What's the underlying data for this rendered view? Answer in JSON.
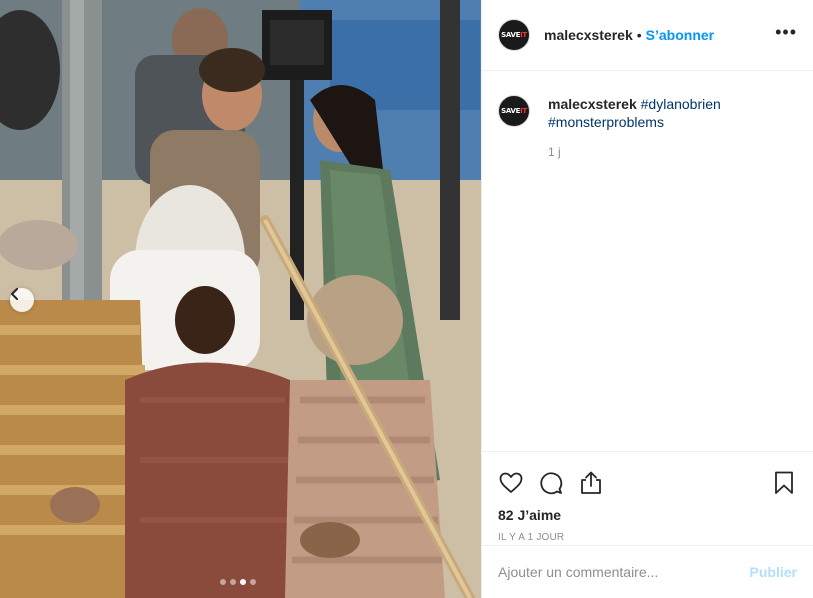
{
  "post": {
    "username": "malecxsterek",
    "follow_label": "S’abonner",
    "separator": "•",
    "more_label": "•••",
    "avatar_text_left": "SAVE",
    "avatar_text_right": "IT",
    "caption": {
      "username": "malecxsterek",
      "tags": [
        "#dylanobrien",
        "#monsterproblems"
      ],
      "time": "1 j"
    },
    "likes": "82 J’aime",
    "posted_ago": "IL Y A 1 JOUR",
    "comment_placeholder": "Ajouter un commentaire...",
    "publish_label": "Publier"
  },
  "carousel": {
    "slide_count": 4,
    "active_index": 2,
    "prev_icon": "chevron-left-icon"
  },
  "icons": {
    "like": "heart-icon",
    "comment": "comment-bubble-icon",
    "share": "share-icon",
    "save": "bookmark-icon"
  },
  "colors": {
    "accent": "#0095f6",
    "link": "#003569",
    "publish_disabled": "#b2dffc",
    "muted": "#8e8e8e"
  }
}
